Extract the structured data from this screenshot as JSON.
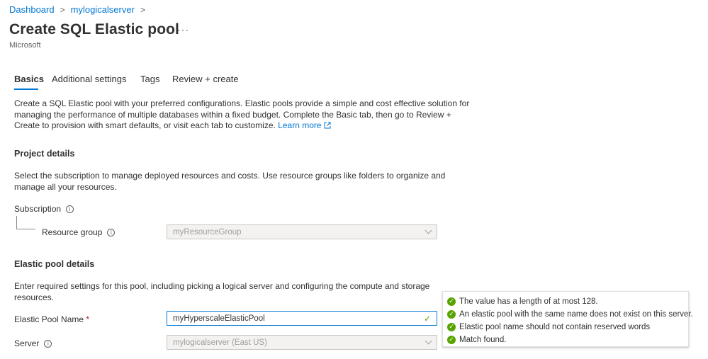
{
  "breadcrumb": {
    "items": [
      "Dashboard",
      "mylogicalserver"
    ],
    "separator": ">"
  },
  "header": {
    "title": "Create SQL Elastic pool",
    "more": "···",
    "publisher": "Microsoft"
  },
  "tabs": [
    {
      "label": "Basics",
      "active": true
    },
    {
      "label": "Additional settings",
      "active": false
    },
    {
      "label": "Tags",
      "active": false
    },
    {
      "label": "Review + create",
      "active": false
    }
  ],
  "intro": {
    "lines": [
      "Create a SQL Elastic pool with your preferred configurations. Elastic pools provide a simple and cost effective solution for",
      "managing the performance of multiple databases within a fixed budget. Complete the Basic tab, then go to Review +",
      "Create to provision with smart defaults, or visit each tab to customize."
    ],
    "learn_more": "Learn more",
    "learn_more_icon": "external-link-icon"
  },
  "project": {
    "heading": "Project details",
    "lines": [
      "Select the subscription to manage deployed resources and costs. Use resource groups like folders to organize and",
      "manage all your resources."
    ],
    "subscription_label": "Subscription",
    "resource_group_label": "Resource group",
    "resource_group_value": "myResourceGroup"
  },
  "pool": {
    "heading": "Elastic pool details",
    "lines": [
      "Enter required settings for this pool, including picking a logical server and configuring the compute and storage",
      "resources."
    ],
    "name_label": "Elastic Pool Name",
    "required_mark": "*",
    "name_value": "myHyperscaleElasticPool",
    "server_label": "Server",
    "server_value": "mylogicalserver (East US)"
  },
  "validation": {
    "messages": [
      "The value has a length of at most 128.",
      "An elastic pool with the same name does not exist on this server.",
      "Elastic pool name should not contain reserved words",
      "Match found."
    ]
  },
  "colors": {
    "accent": "#0078d4",
    "success": "#57a300",
    "required": "#a4262c"
  }
}
